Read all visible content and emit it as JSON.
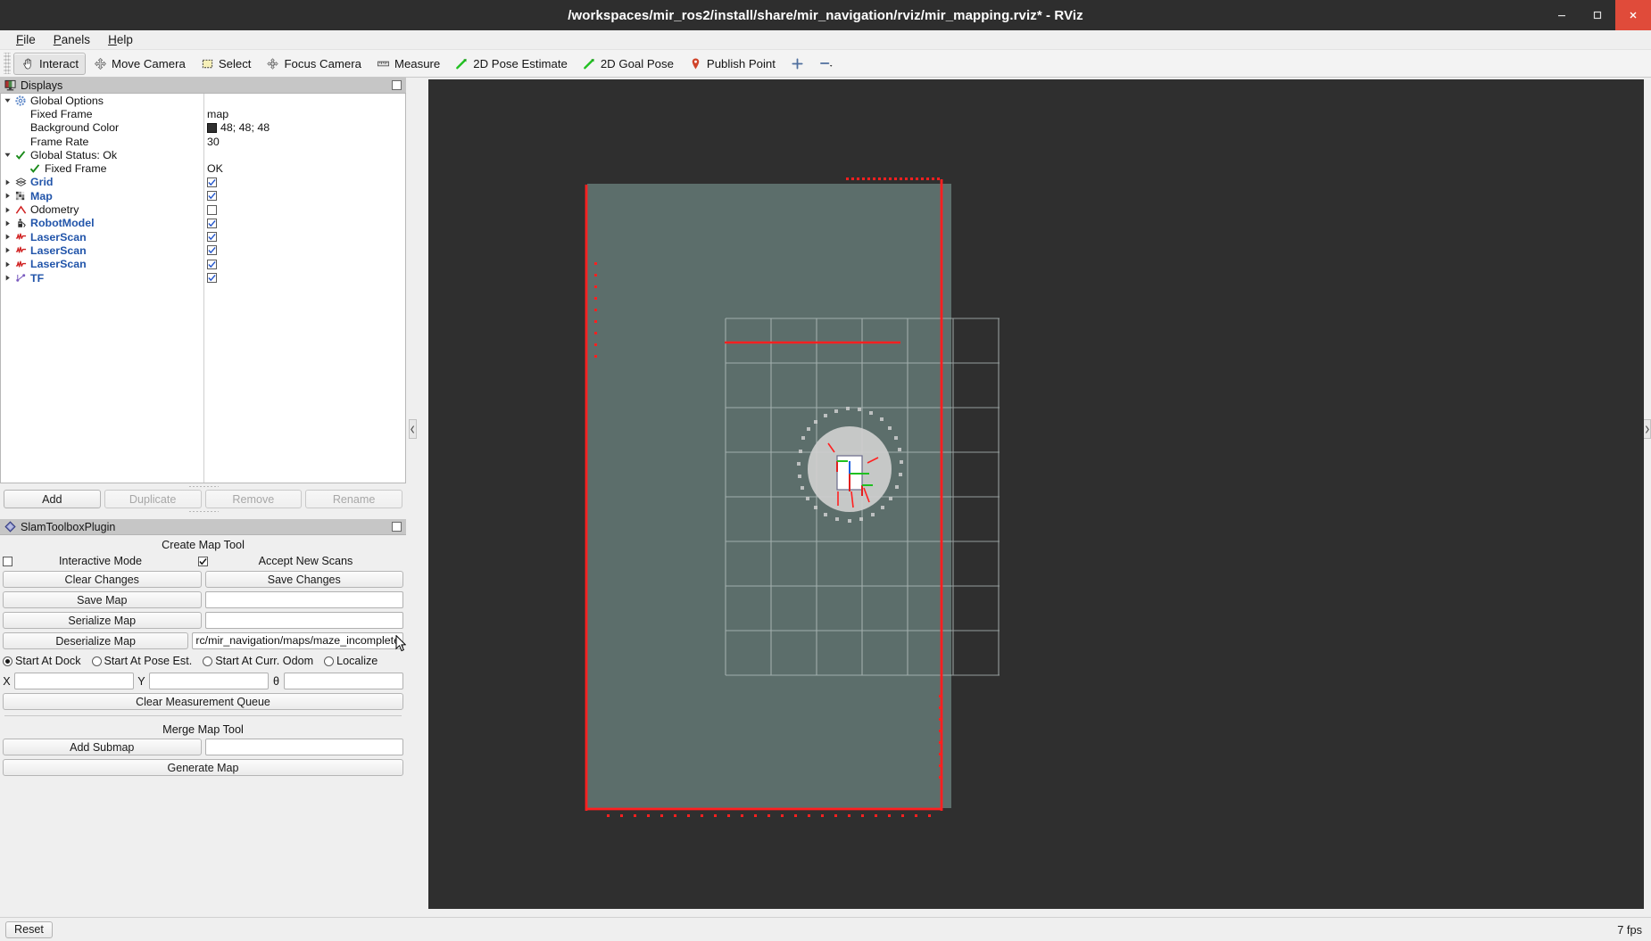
{
  "window": {
    "title": "/workspaces/mir_ros2/install/share/mir_navigation/rviz/mir_mapping.rviz* - RViz",
    "minimize_label": "minimize-icon",
    "maximize_label": "maximize-icon",
    "close_label": "close-icon"
  },
  "menu": {
    "items": [
      {
        "label": "File",
        "mnemonic": "F"
      },
      {
        "label": "Panels",
        "mnemonic": "P"
      },
      {
        "label": "Help",
        "mnemonic": "H"
      }
    ]
  },
  "toolbar": {
    "items": [
      {
        "label": "Interact",
        "icon": "hand-cursor-icon",
        "active": true
      },
      {
        "label": "Move Camera",
        "icon": "move-camera-icon",
        "active": false
      },
      {
        "label": "Select",
        "icon": "select-rect-icon",
        "active": false
      },
      {
        "label": "Focus Camera",
        "icon": "focus-camera-icon",
        "active": false
      },
      {
        "label": "Measure",
        "icon": "ruler-icon",
        "active": false
      },
      {
        "label": "2D Pose Estimate",
        "icon": "green-arrow-icon",
        "active": false
      },
      {
        "label": "2D Goal Pose",
        "icon": "green-arrow-icon",
        "active": false
      },
      {
        "label": "Publish Point",
        "icon": "map-pin-icon",
        "active": false
      },
      {
        "label": "",
        "icon": "plus-icon",
        "active": false
      },
      {
        "label": "",
        "icon": "minus-dropdown-icon",
        "active": false
      }
    ]
  },
  "displays_panel": {
    "title": "Displays",
    "icon": "displays-panel-icon",
    "rows": [
      {
        "label": "Global Options",
        "value": "",
        "indent": 0,
        "arrow": "down",
        "icon": "gear-icon",
        "style": "plain",
        "control": "none"
      },
      {
        "label": "Fixed Frame",
        "value": "map",
        "indent": 2,
        "arrow": "none",
        "icon": "none",
        "style": "plain",
        "control": "text"
      },
      {
        "label": "Background Color",
        "value": "48; 48; 48",
        "indent": 2,
        "arrow": "none",
        "icon": "none",
        "style": "plain",
        "control": "color",
        "color": "#303030"
      },
      {
        "label": "Frame Rate",
        "value": "30",
        "indent": 2,
        "arrow": "none",
        "icon": "none",
        "style": "plain",
        "control": "text"
      },
      {
        "label": "Global Status: Ok",
        "value": "",
        "indent": 0,
        "arrow": "down",
        "icon": "check-icon",
        "style": "plain",
        "control": "none"
      },
      {
        "label": "Fixed Frame",
        "value": "OK",
        "indent": 2,
        "arrow": "none",
        "icon": "check-icon",
        "style": "plain",
        "control": "text"
      },
      {
        "label": "Grid",
        "value": "",
        "indent": 0,
        "arrow": "right",
        "icon": "grid-icon",
        "style": "bold-blue",
        "control": "checkbox",
        "checked": true
      },
      {
        "label": "Map",
        "value": "",
        "indent": 0,
        "arrow": "right",
        "icon": "map-icon",
        "style": "bold-blue",
        "control": "checkbox",
        "checked": true
      },
      {
        "label": "Odometry",
        "value": "",
        "indent": 0,
        "arrow": "right",
        "icon": "odometry-icon",
        "style": "plain",
        "control": "checkbox",
        "checked": false
      },
      {
        "label": "RobotModel",
        "value": "",
        "indent": 0,
        "arrow": "right",
        "icon": "robot-icon",
        "style": "bold-blue",
        "control": "checkbox",
        "checked": true
      },
      {
        "label": "LaserScan",
        "value": "",
        "indent": 0,
        "arrow": "right",
        "icon": "laserscan-icon",
        "style": "bold-blue",
        "control": "checkbox",
        "checked": true
      },
      {
        "label": "LaserScan",
        "value": "",
        "indent": 0,
        "arrow": "right",
        "icon": "laserscan-icon",
        "style": "bold-blue",
        "control": "checkbox",
        "checked": true
      },
      {
        "label": "LaserScan",
        "value": "",
        "indent": 0,
        "arrow": "right",
        "icon": "laserscan-icon",
        "style": "bold-blue",
        "control": "checkbox",
        "checked": true
      },
      {
        "label": "TF",
        "value": "",
        "indent": 0,
        "arrow": "right",
        "icon": "tf-icon",
        "style": "bold-blue",
        "control": "checkbox",
        "checked": true
      }
    ],
    "buttons": [
      {
        "label": "Add",
        "enabled": true
      },
      {
        "label": "Duplicate",
        "enabled": false
      },
      {
        "label": "Remove",
        "enabled": false
      },
      {
        "label": "Rename",
        "enabled": false
      }
    ]
  },
  "slam_panel": {
    "title": "SlamToolboxPlugin",
    "icon": "slam-plugin-icon",
    "create_map_tool_label": "Create Map Tool",
    "interactive_mode_label": "Interactive Mode",
    "interactive_mode_checked": true,
    "accept_new_scans_label": "Accept New Scans",
    "accept_new_scans_checked": false,
    "clear_changes_label": "Clear Changes",
    "save_changes_label": "Save Changes",
    "save_map_label": "Save Map",
    "save_map_value": "",
    "save_map_placeholder": "",
    "serialize_map_label": "Serialize Map",
    "serialize_map_value": "",
    "deserialize_map_label": "Deserialize Map",
    "deserialize_map_value": "rc/mir_navigation/maps/maze_incomplete",
    "start_modes": [
      {
        "label": "Start At Dock",
        "selected": true
      },
      {
        "label": "Start At Pose Est.",
        "selected": false
      },
      {
        "label": "Start At Curr. Odom",
        "selected": false
      },
      {
        "label": "Localize",
        "selected": false
      }
    ],
    "x_label": "X",
    "x_value": "",
    "y_label": "Y",
    "y_value": "",
    "theta_label": "θ",
    "theta_value": "",
    "clear_measurement_queue_label": "Clear Measurement Queue",
    "merge_map_tool_label": "Merge Map Tool",
    "add_submap_label": "Add Submap",
    "add_submap_value": "",
    "generate_map_label": "Generate Map"
  },
  "statusbar": {
    "reset_label": "Reset",
    "fps_label": "7 fps"
  },
  "viewport": {
    "background_color": "#2f2f2f",
    "map_free_color": "#5c6e6b",
    "grid_line_color": "#b9c4c2",
    "scan_color": "#ff2020",
    "robot_color": "#ffffff",
    "unknown_cell_color": "#cfcfcf"
  }
}
